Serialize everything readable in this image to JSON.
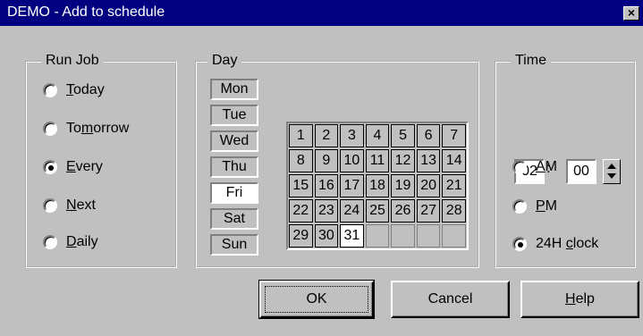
{
  "window": {
    "title": "DEMO - Add to schedule",
    "close_label": "×"
  },
  "run_job": {
    "legend": "Run Job",
    "options": [
      {
        "pre": "",
        "key": "T",
        "post": "oday",
        "checked": false
      },
      {
        "pre": "To",
        "key": "m",
        "post": "orrow",
        "checked": false
      },
      {
        "pre": "",
        "key": "E",
        "post": "very",
        "checked": true
      },
      {
        "pre": "",
        "key": "N",
        "post": "ext",
        "checked": false
      },
      {
        "pre": "",
        "key": "D",
        "post": "aily",
        "checked": false
      }
    ]
  },
  "day": {
    "legend": "Day",
    "weekdays": [
      "Mon",
      "Tue",
      "Wed",
      "Thu",
      "Fri",
      "Sat",
      "Sun"
    ],
    "selected_weekday": "Fri",
    "calendar_dates": [
      "1",
      "2",
      "3",
      "4",
      "5",
      "6",
      "7",
      "8",
      "9",
      "10",
      "11",
      "12",
      "13",
      "14",
      "15",
      "16",
      "17",
      "18",
      "19",
      "20",
      "21",
      "22",
      "23",
      "24",
      "25",
      "26",
      "27",
      "28",
      "29",
      "30",
      "31",
      "",
      "",
      "",
      ""
    ],
    "selected_date": "31"
  },
  "time": {
    "legend": "Time",
    "hour": "02",
    "minute": "00",
    "separator": ":",
    "options": [
      {
        "pre": "",
        "key": "A",
        "post": "M",
        "checked": false
      },
      {
        "pre": "",
        "key": "P",
        "post": "M",
        "checked": false
      },
      {
        "pre": "24H ",
        "key": "c",
        "post": "lock",
        "checked": true
      }
    ]
  },
  "buttons": {
    "ok": "OK",
    "cancel": "Cancel",
    "help_key": "H",
    "help_rest": "elp"
  }
}
